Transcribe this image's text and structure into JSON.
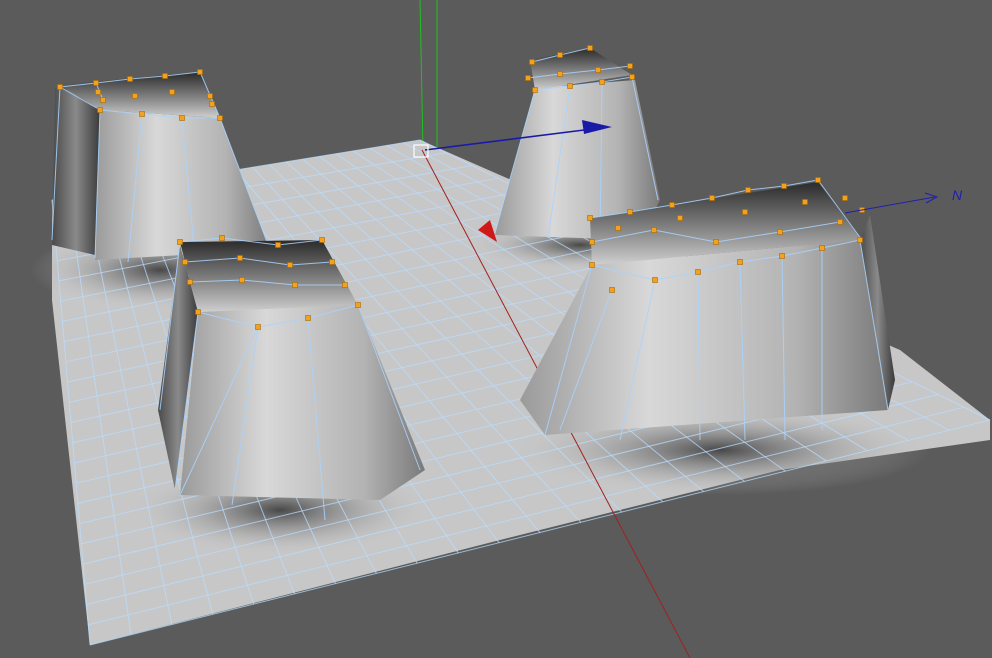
{
  "viewport": {
    "background": "#5b5b5b",
    "wire_color": "#a9d4ff",
    "vertex_color": "#f4a21e",
    "ground_color": "#c7c7c7"
  },
  "axes": {
    "x_axis_color": "#d01010",
    "y_axis_color": "#20c020",
    "z_axis_color": "#2020c0",
    "z_label": "N"
  },
  "gizmo": {
    "x_handle_color": "#d01818",
    "z_handle_color": "#1a1aa8",
    "center_icon": "pivot-square-icon"
  }
}
